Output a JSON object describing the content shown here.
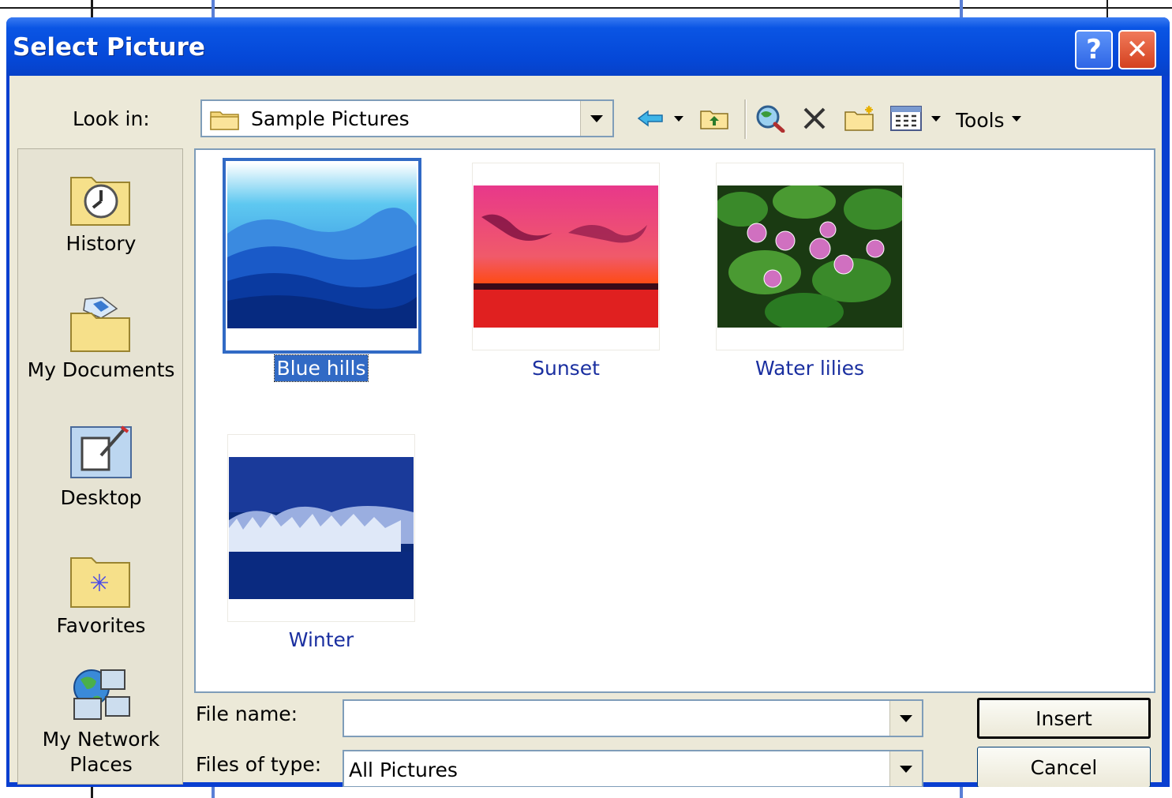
{
  "dialog": {
    "title": "Select Picture",
    "help_button": "?",
    "close_button": "✕"
  },
  "toolbar": {
    "lookin_label": "Look in:",
    "lookin_value": "Sample Pictures",
    "tools_label": "Tools",
    "icons": [
      "back-icon",
      "up-folder-icon",
      "search-web-icon",
      "delete-icon",
      "new-folder-icon",
      "views-icon"
    ]
  },
  "places": [
    {
      "label": "History",
      "icon": "history-icon"
    },
    {
      "label": "My Documents",
      "icon": "my-documents-icon"
    },
    {
      "label": "Desktop",
      "icon": "desktop-icon"
    },
    {
      "label": "Favorites",
      "icon": "favorites-icon"
    },
    {
      "label": "My Network Places",
      "icon": "network-places-icon"
    }
  ],
  "files": [
    {
      "name": "Blue hills",
      "selected": true
    },
    {
      "name": "Sunset",
      "selected": false
    },
    {
      "name": "Water lilies",
      "selected": false
    },
    {
      "name": "Winter",
      "selected": false
    }
  ],
  "form": {
    "file_name_label": "File name:",
    "file_name_value": "",
    "file_type_label": "Files of type:",
    "file_type_value": "All Pictures"
  },
  "buttons": {
    "insert": "Insert",
    "cancel": "Cancel"
  },
  "colors": {
    "titlebar": "#0548d8",
    "selection": "#316ac5",
    "caption_text": "#1a2fa0"
  }
}
